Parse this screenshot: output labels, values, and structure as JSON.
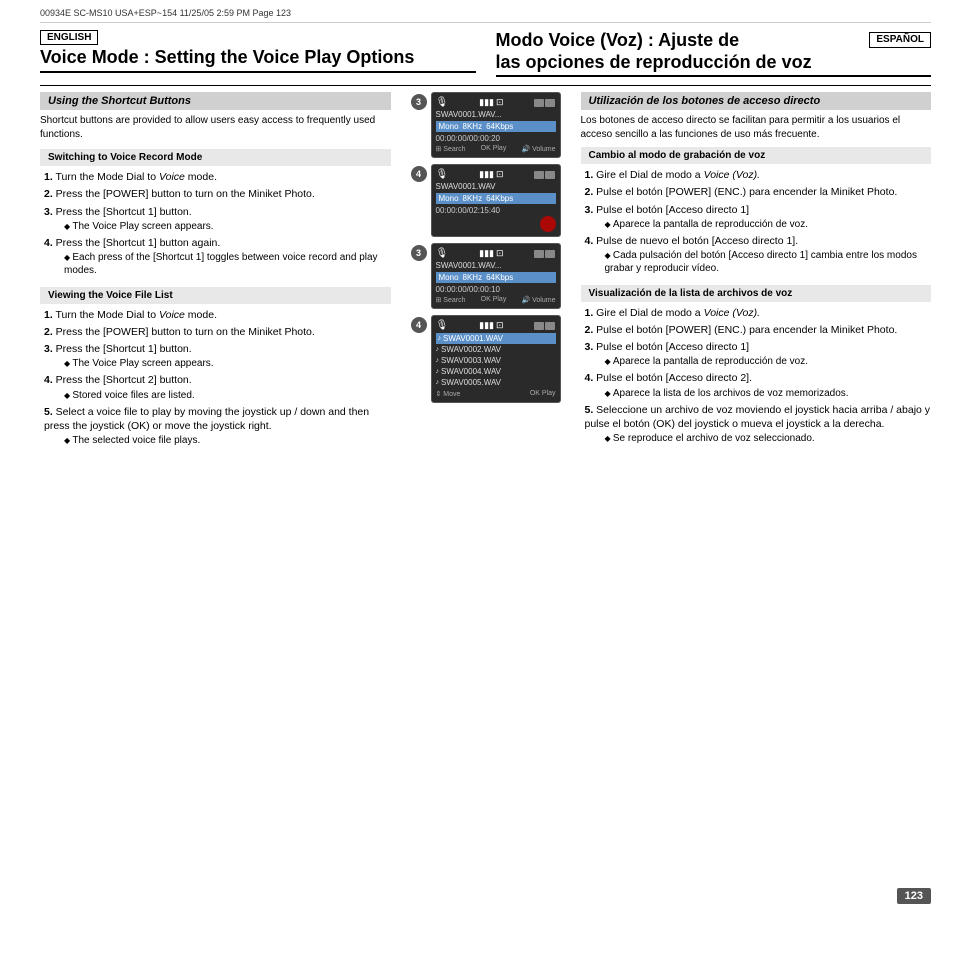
{
  "header": {
    "text": "00934E  SC-MS10  USA+ESP~154   11/25/05  2:59 PM    Page 123"
  },
  "english": {
    "badge": "ENGLISH",
    "title_line1": "Voice Mode : Setting the Voice Play Options",
    "shortcut_section": "Using the Shortcut Buttons",
    "switching_subsection": "Switching to Voice Record Mode",
    "steps_switching": [
      {
        "num": "1.",
        "text": "Turn the Mode Dial to ",
        "italic": "Voice",
        "rest": " mode."
      },
      {
        "num": "2.",
        "text": "Press the [POWER] button to turn on the Miniket Photo."
      },
      {
        "num": "3.",
        "text": "Press the [Shortcut 1] button."
      },
      {
        "num": "4.",
        "text": "Press the [Shortcut 1] button again."
      }
    ],
    "sub3": "The Voice Play screen appears.",
    "sub4a": "Each press of the [Shortcut 1] toggles",
    "sub4b": "between voice record and play modes.",
    "viewing_subsection": "Viewing the Voice File List",
    "vsteps": [
      {
        "num": "1.",
        "text": "Turn the Mode Dial to ",
        "italic": "Voice",
        "rest": " mode."
      },
      {
        "num": "2.",
        "text": "Press the [POWER] button to turn on the Miniket Photo."
      },
      {
        "num": "3.",
        "text": "Press the [Shortcut 1] button."
      },
      {
        "num": "4.",
        "text": "Press the [Shortcut 2] button."
      },
      {
        "num": "5.",
        "text": "Select a voice file to play by moving the joystick up / down and then press the joystick (OK) or move the joystick right."
      }
    ],
    "vsub3": "The Voice Play screen appears.",
    "vsub4": "Stored voice files are listed.",
    "vsub5": "The selected voice file plays."
  },
  "spanish": {
    "badge": "ESPAÑOL",
    "title_line1": "Modo Voice (Voz) : Ajuste de",
    "title_line2": "las opciones de reproducción de voz",
    "shortcut_section": "Utilización de los botones de acceso directo",
    "shortcut_desc": "Los botones de acceso directo se facilitan para permitir a los usuarios el acceso sencillo a las funciones de uso más frecuente.",
    "switching_subsection": "Cambio al modo de grabación de voz",
    "steps_switching": [
      {
        "num": "1.",
        "text": "Gire el Dial de modo a ",
        "italic": "Voice (Voz)."
      },
      {
        "num": "2.",
        "text": "Pulse el botón [POWER] (ENC.) para encender la Miniket Photo."
      },
      {
        "num": "3.",
        "text": "Pulse el botón [Acceso directo 1]"
      },
      {
        "num": "4.",
        "text": "Pulse de nuevo el botón [Acceso directo 1]."
      }
    ],
    "sub3": "Aparece la pantalla de reproducción de voz.",
    "sub4a": "Cada pulsación del botón [Acceso directo 1]",
    "sub4b": "cambia entre los modos grabar y reproducir",
    "sub4c": "vídeo.",
    "viewing_subsection": "Visualización de la lista de archivos de voz",
    "vsteps": [
      {
        "num": "1.",
        "text": "Gire el Dial de modo a ",
        "italic": "Voice (Voz)."
      },
      {
        "num": "2.",
        "text": "Pulse el botón [POWER] (ENC.) para encender la Miniket Photo."
      },
      {
        "num": "3.",
        "text": "Pulse el botón [Acceso directo 1]"
      },
      {
        "num": "4.",
        "text": "Pulse el botón [Acceso directo 2]."
      },
      {
        "num": "5.",
        "text": "Seleccione un archivo de voz moviendo el joystick hacia arriba / abajo y pulse el botón (OK) del joystick o mueva el joystick a la derecha."
      }
    ],
    "vsub3": "Aparece la pantalla de reproducción de voz.",
    "vsub4": "Aparece la lista de los archivos de voz memorizados.",
    "vsub5": "Se reproduce el archivo de voz seleccionado."
  },
  "en_shortcut_desc": "Shortcut buttons are provided to allow users easy access to frequently used functions.",
  "screens": {
    "screen1": {
      "filename": "SWAV0001.WAV...",
      "tags": "Mono  8KHz  64Kbps",
      "time": "00:00:00/00:00:20",
      "footer": "Search  OK Play  Volume"
    },
    "screen2": {
      "filename": "SWAV0001.WAV",
      "tags": "Mono  8KHz  64Kbps",
      "time": "00:00:00/02:15:40",
      "footer": ""
    },
    "screen3": {
      "filename": "SWAV0001.WAV...",
      "tags": "Mono  8KHz  64Kbps",
      "time": "00:00:00/00:00:10",
      "footer": "Search  OK Play  Volume"
    },
    "screen4": {
      "files": [
        "SWAV0001.WAV",
        "SWAV0002.WAV",
        "SWAV0003.WAV",
        "SWAV0004.WAV",
        "SWAV0005.WAV"
      ],
      "footer": "Move  OK Play"
    }
  },
  "page_number": "123"
}
